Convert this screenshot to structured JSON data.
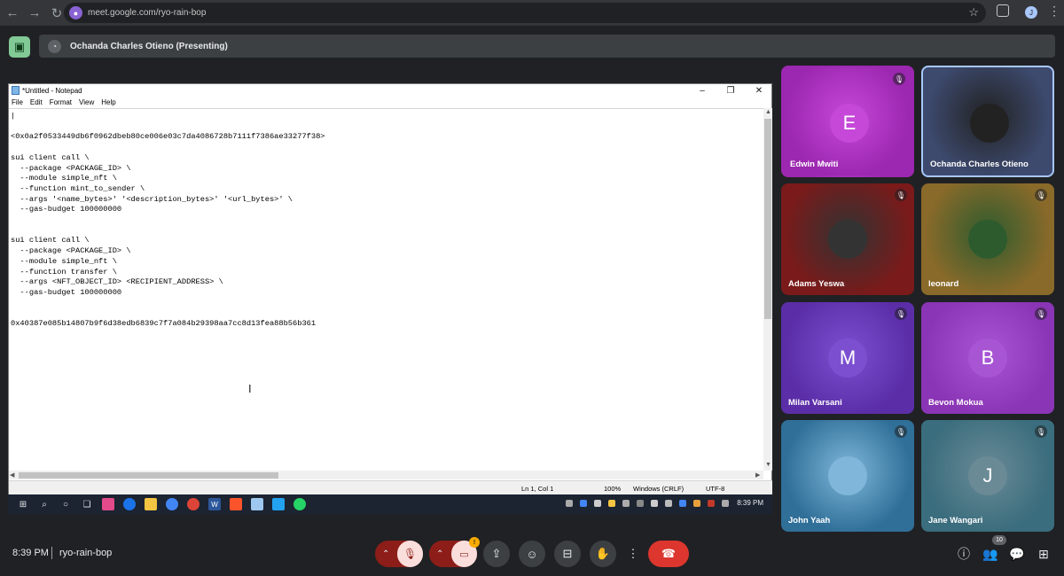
{
  "browser": {
    "url": "meet.google.com/ryo-rain-bop",
    "profile_initial": "J"
  },
  "meet": {
    "presenting_label": "Ochanda Charles Otieno (Presenting)",
    "time": "8:39 PM",
    "meeting_code": "ryo-rain-bop",
    "participant_count": "10",
    "camera_warning": "!",
    "participants": [
      {
        "name": "Edwin Mwiti",
        "initial": "E",
        "bg": "#9c27b0",
        "avatar_bg": "#c548d8",
        "muted": true,
        "photo": false
      },
      {
        "name": "Ochanda Charles Otieno",
        "initial": "",
        "bg": "#3d4a6e",
        "avatar_bg": "#222",
        "muted": false,
        "photo": true
      },
      {
        "name": "Adams Yeswa",
        "initial": "",
        "bg": "#7a1a1a",
        "avatar_bg": "#333",
        "muted": true,
        "photo": true
      },
      {
        "name": "leonard",
        "initial": "",
        "bg": "#8a6a2a",
        "avatar_bg": "#2e5b2e",
        "muted": true,
        "photo": true
      },
      {
        "name": "Milan Varsani",
        "initial": "M",
        "bg": "#5b2ea8",
        "avatar_bg": "#7b4fd0",
        "muted": true,
        "photo": false
      },
      {
        "name": "Bevon Mokua",
        "initial": "B",
        "bg": "#8a35b5",
        "avatar_bg": "#a855d4",
        "muted": true,
        "photo": false
      },
      {
        "name": "John Yaah",
        "initial": "",
        "bg": "#2f6f98",
        "avatar_bg": "#7fb6d9",
        "muted": true,
        "photo": true
      },
      {
        "name": "Jane Wangari",
        "initial": "J",
        "bg": "#3a6d7d",
        "avatar_bg": "#6a8a96",
        "muted": true,
        "photo": false
      }
    ]
  },
  "notepad": {
    "title": "*Untitled - Notepad",
    "menu": [
      "File",
      "Edit",
      "Format",
      "View",
      "Help"
    ],
    "content": "|\n\n<0x0a2f0533449db6f0962dbeb80ce006e03c7da4086728b7111f7386ae33277f38>\n\nsui client call \\\n  --package <PACKAGE_ID> \\\n  --module simple_nft \\\n  --function mint_to_sender \\\n  --args '<name_bytes>' '<description_bytes>' '<url_bytes>' \\\n  --gas-budget 100000000\n\n\nsui client call \\\n  --package <PACKAGE_ID> \\\n  --module simple_nft \\\n  --function transfer \\\n  --args <NFT_OBJECT_ID> <RECIPIENT_ADDRESS> \\\n  --gas-budget 100000000\n\n\n0x40387e085b14807b9f6d38edb6839c7f7a084b29398aa7cc8d13fea88b56b361",
    "status_position": "Ln 1, Col 1",
    "status_zoom": "100%",
    "status_eol": "Windows (CRLF)",
    "status_encoding": "UTF-8"
  },
  "taskbar": {
    "clock": "8:39 PM"
  }
}
